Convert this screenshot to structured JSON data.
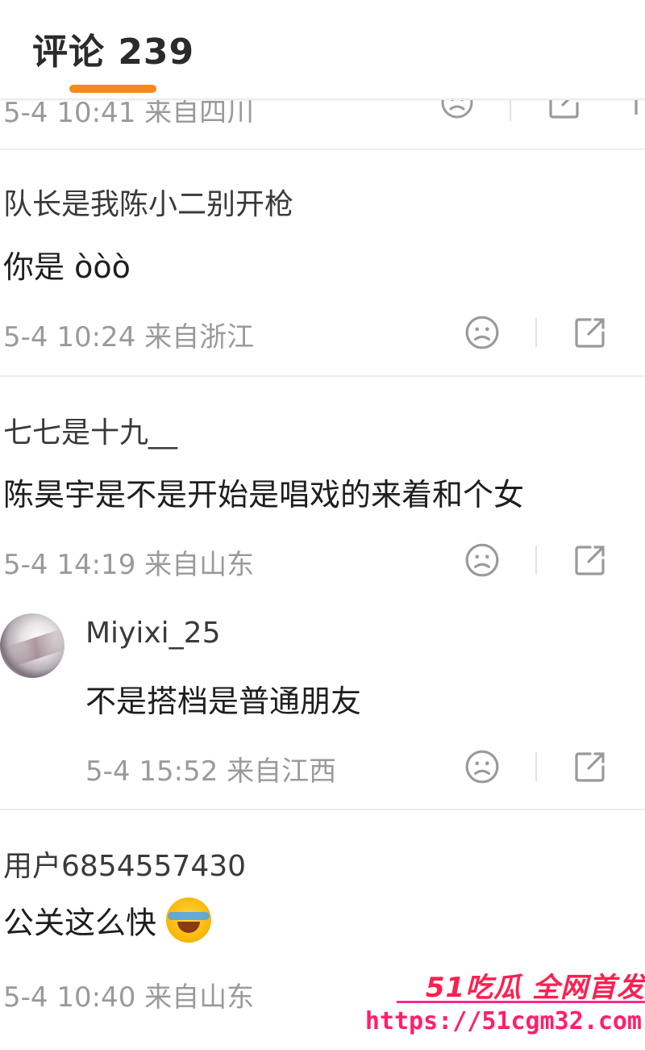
{
  "header": {
    "tab_label": "评论 239"
  },
  "colors": {
    "accent": "#f5891f",
    "meta": "#9a9a9a",
    "watermark": "#ff1f4f"
  },
  "icons": {
    "dislike": "sad-face-icon",
    "share": "share-icon"
  },
  "comments": [
    {
      "meta": "5-4 10:41 来自四川"
    },
    {
      "username": "队长是我陈小二别开枪",
      "text": "你是 òòò",
      "meta": "5-4 10:24 来自浙江"
    },
    {
      "username": "七七是十九__",
      "text": "陈昊宇是不是开始是唱戏的来着和个女",
      "meta": "5-4 14:19 来自山东",
      "reply": {
        "username": "Miyixi_25",
        "text": "不是搭档是普通朋友",
        "meta": "5-4 15:52 来自江西"
      }
    },
    {
      "username": "用户6854557430",
      "text": "公关这么快",
      "meta": "5-4 10:40 来自山东"
    }
  ],
  "watermark": {
    "brand": "51吃瓜 全网首发",
    "url": "https://51cgm32.com"
  }
}
